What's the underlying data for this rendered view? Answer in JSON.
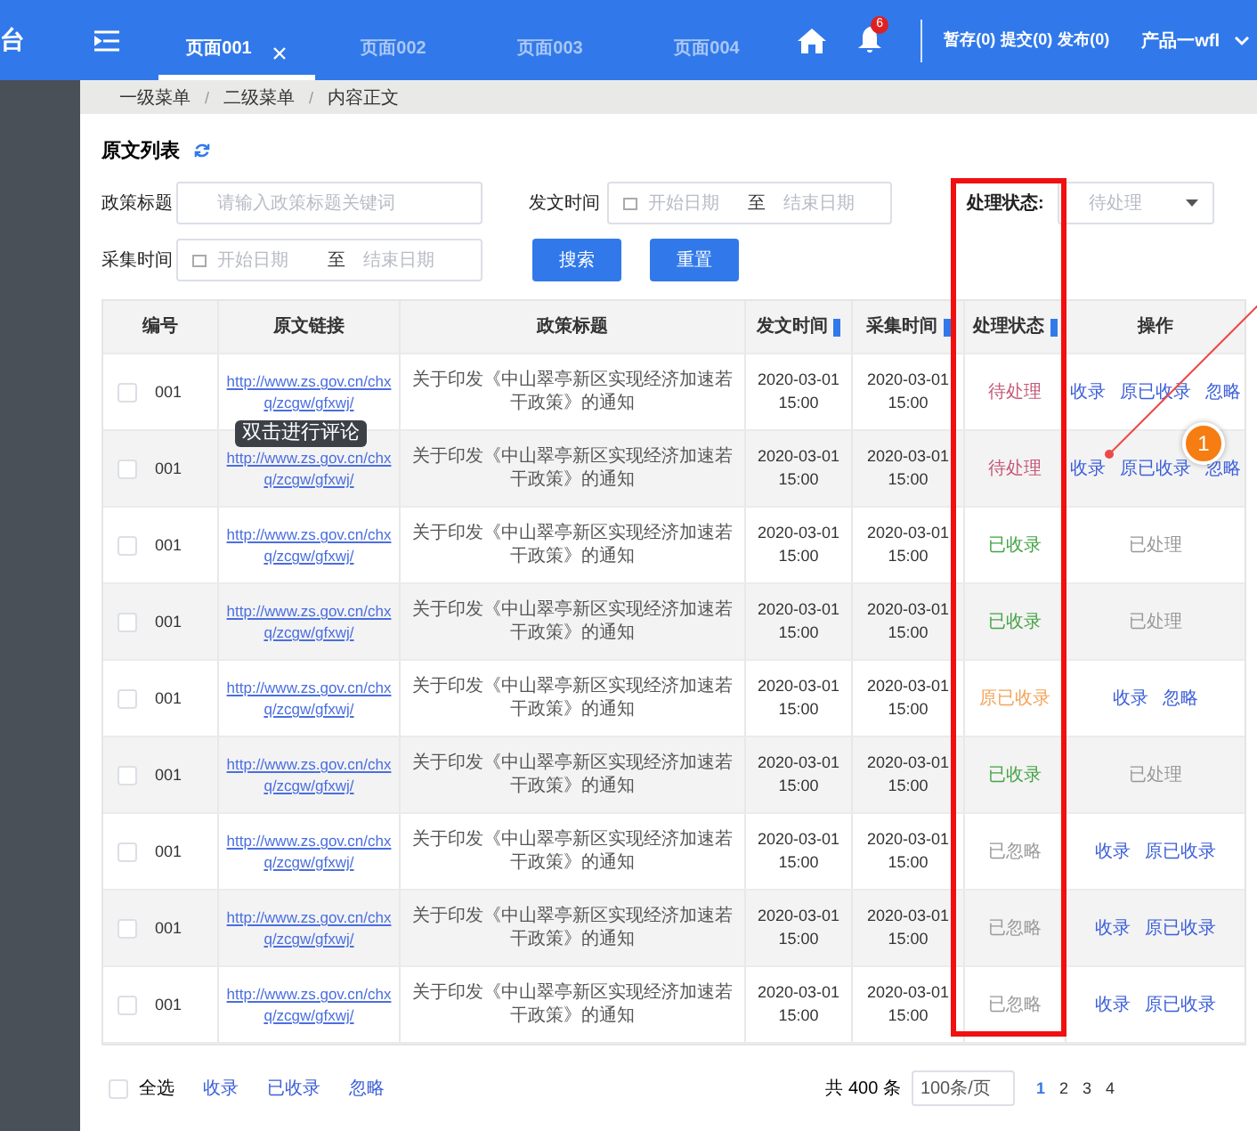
{
  "sidebar": {
    "logo_fragment": "台"
  },
  "header": {
    "tabs": [
      {
        "label": "页面001",
        "selected": true,
        "closable": true
      },
      {
        "label": "页面002",
        "selected": false,
        "closable": false
      },
      {
        "label": "页面003",
        "selected": false,
        "closable": false
      },
      {
        "label": "页面004",
        "selected": false,
        "closable": false
      }
    ],
    "notification_count": "6",
    "counters": [
      "暂存(0)",
      "提交(0)",
      "发布(0)"
    ],
    "user": "产品一wfl"
  },
  "breadcrumb": [
    {
      "label": "一级菜单",
      "separator": "/"
    },
    {
      "label": "二级菜单",
      "separator": "/"
    },
    {
      "label": "内容正文"
    }
  ],
  "section_title": "原文列表",
  "filters": {
    "title_label": "政策标题",
    "title_placeholder": "请输入政策标题关键词",
    "publish_label": "发文时间",
    "publish_range": {
      "start_placeholder": "开始日期",
      "separator": "至",
      "end_placeholder": "结束日期"
    },
    "collect_label": "采集时间",
    "collect_range": {
      "start_placeholder": "开始日期",
      "separator": "至",
      "end_placeholder": "结束日期"
    },
    "status_label": "处理状态:",
    "status_value": "待处理",
    "search_button": "搜索",
    "reset_button": "重置"
  },
  "table": {
    "columns": [
      "编号",
      "原文链接",
      "政策标题",
      "发文时间",
      "采集时间",
      "处理状态",
      "操作"
    ],
    "rows": [
      {
        "checked": false,
        "id": "001",
        "link": "http://www.zs.gov.cn/chxq/zcgw/gfxwj/",
        "title": "关于印发《中山翠亭新区实现经济加速若干政策》的通知",
        "published": "2020-03-01 15:00",
        "collected": "2020-03-01 15:00",
        "status": {
          "label": "待处理",
          "kind": "pending"
        },
        "actions": [
          {
            "label": "收录",
            "kind": "link"
          },
          {
            "label": "原已收录",
            "kind": "link"
          },
          {
            "label": "忽略",
            "kind": "link"
          }
        ]
      },
      {
        "checked": false,
        "id": "001",
        "link": "http://www.zs.gov.cn/chxq/zcgw/gfxwj/",
        "title": "关于印发《中山翠亭新区实现经济加速若干政策》的通知",
        "published": "2020-03-01 15:00",
        "collected": "2020-03-01 15:00",
        "status": {
          "label": "待处理",
          "kind": "pending"
        },
        "actions": [
          {
            "label": "收录",
            "kind": "link"
          },
          {
            "label": "原已收录",
            "kind": "link"
          },
          {
            "label": "忽略",
            "kind": "link"
          }
        ]
      },
      {
        "checked": false,
        "id": "001",
        "link": "http://www.zs.gov.cn/chxq/zcgw/gfxwj/",
        "title": "关于印发《中山翠亭新区实现经济加速若干政策》的通知",
        "published": "2020-03-01 15:00",
        "collected": "2020-03-01 15:00",
        "status": {
          "label": "已收录",
          "kind": "collected"
        },
        "actions": [
          {
            "label": "已处理",
            "kind": "done"
          }
        ]
      },
      {
        "checked": false,
        "id": "001",
        "link": "http://www.zs.gov.cn/chxq/zcgw/gfxwj/",
        "title": "关于印发《中山翠亭新区实现经济加速若干政策》的通知",
        "published": "2020-03-01 15:00",
        "collected": "2020-03-01 15:00",
        "status": {
          "label": "已收录",
          "kind": "collected"
        },
        "actions": [
          {
            "label": "已处理",
            "kind": "done"
          }
        ]
      },
      {
        "checked": false,
        "id": "001",
        "link": "http://www.zs.gov.cn/chxq/zcgw/gfxwj/",
        "title": "关于印发《中山翠亭新区实现经济加速若干政策》的通知",
        "published": "2020-03-01 15:00",
        "collected": "2020-03-01 15:00",
        "status": {
          "label": "原已收录",
          "kind": "previous"
        },
        "actions": [
          {
            "label": "收录",
            "kind": "link"
          },
          {
            "label": "忽略",
            "kind": "link"
          }
        ]
      },
      {
        "checked": false,
        "id": "001",
        "link": "http://www.zs.gov.cn/chxq/zcgw/gfxwj/",
        "title": "关于印发《中山翠亭新区实现经济加速若干政策》的通知",
        "published": "2020-03-01 15:00",
        "collected": "2020-03-01 15:00",
        "status": {
          "label": "已收录",
          "kind": "collected"
        },
        "actions": [
          {
            "label": "已处理",
            "kind": "done"
          }
        ]
      },
      {
        "checked": false,
        "id": "001",
        "link": "http://www.zs.gov.cn/chxq/zcgw/gfxwj/",
        "title": "关于印发《中山翠亭新区实现经济加速若干政策》的通知",
        "published": "2020-03-01 15:00",
        "collected": "2020-03-01 15:00",
        "status": {
          "label": "已忽略",
          "kind": "ignored"
        },
        "actions": [
          {
            "label": "收录",
            "kind": "link"
          },
          {
            "label": "原已收录",
            "kind": "link"
          }
        ]
      },
      {
        "checked": false,
        "id": "001",
        "link": "http://www.zs.gov.cn/chxq/zcgw/gfxwj/",
        "title": "关于印发《中山翠亭新区实现经济加速若干政策》的通知",
        "published": "2020-03-01 15:00",
        "collected": "2020-03-01 15:00",
        "status": {
          "label": "已忽略",
          "kind": "ignored"
        },
        "actions": [
          {
            "label": "收录",
            "kind": "link"
          },
          {
            "label": "原已收录",
            "kind": "link"
          }
        ]
      },
      {
        "checked": false,
        "id": "001",
        "link": "http://www.zs.gov.cn/chxq/zcgw/gfxwj/",
        "title": "关于印发《中山翠亭新区实现经济加速若干政策》的通知",
        "published": "2020-03-01 15:00",
        "collected": "2020-03-01 15:00",
        "status": {
          "label": "已忽略",
          "kind": "ignored"
        },
        "actions": [
          {
            "label": "收录",
            "kind": "link"
          },
          {
            "label": "原已收录",
            "kind": "link"
          }
        ]
      }
    ],
    "tooltip": "双击进行评论"
  },
  "annotation": {
    "marker": "1"
  },
  "footer": {
    "select_all_label": "全选",
    "select_all_checked": false,
    "bulk_actions": [
      "收录",
      "已收录",
      "忽略"
    ],
    "total": "共 400 条",
    "page_size": "100条/页",
    "pages": [
      {
        "label": "1",
        "selected": true
      },
      {
        "label": "2",
        "selected": false
      },
      {
        "label": "3",
        "selected": false
      },
      {
        "label": "4",
        "selected": false
      }
    ]
  }
}
